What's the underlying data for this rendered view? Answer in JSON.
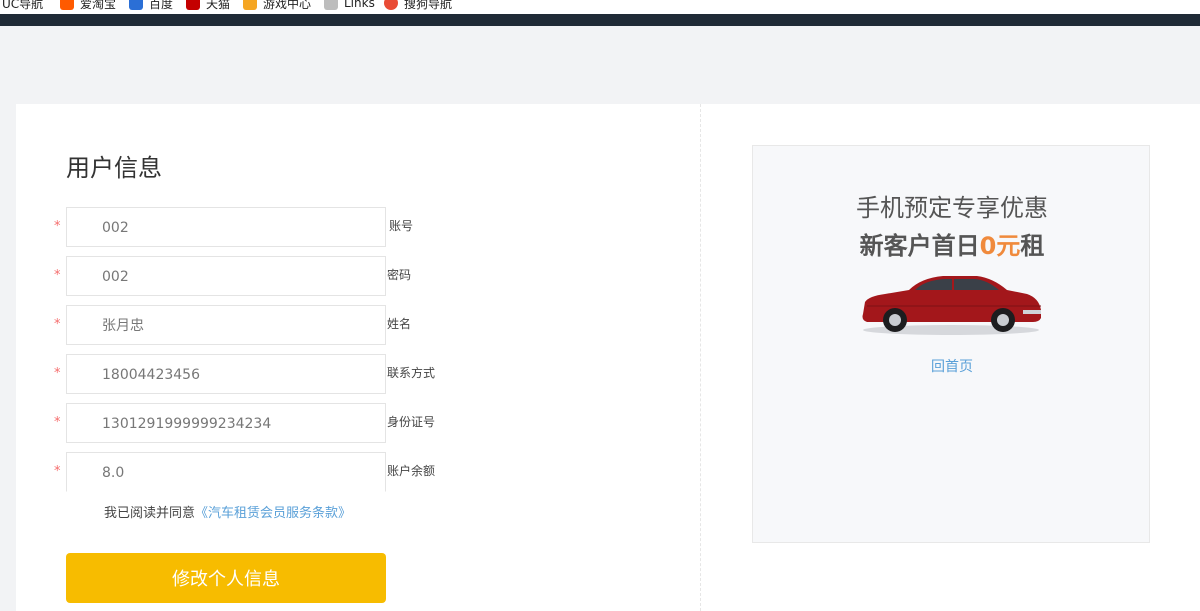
{
  "bookmarks": [
    {
      "label": "UC导航",
      "icon": "uc-icon",
      "color": "#f39c12"
    },
    {
      "label": "爱淘宝",
      "icon": "taobao-icon",
      "color": "#ff5a00"
    },
    {
      "label": "百度",
      "icon": "baidu-icon",
      "color": "#2b6fd6"
    },
    {
      "label": "天猫",
      "icon": "tmall-icon",
      "color": "#c40000"
    },
    {
      "label": "游戏中心",
      "icon": "game-center-icon",
      "color": "#f5a623"
    },
    {
      "label": "Links",
      "icon": "folder-icon",
      "color": "#bdbdbd"
    },
    {
      "label": "搜狗导航",
      "icon": "sogou-icon",
      "color": "#e94b35"
    }
  ],
  "page": {
    "title": "用户信息",
    "required_mark": "*"
  },
  "form": {
    "fields": [
      {
        "name": "account",
        "label": "账号",
        "value": "002"
      },
      {
        "name": "password",
        "label": "密码",
        "value": "002"
      },
      {
        "name": "realname",
        "label": "姓名",
        "value": "张月忠"
      },
      {
        "name": "phone",
        "label": "联系方式",
        "value": "18004423456"
      },
      {
        "name": "id-number",
        "label": "身份证号",
        "value": "1301291999999234234"
      },
      {
        "name": "balance",
        "label": "账户余额",
        "value": "8.0"
      }
    ],
    "agree_text": "我已阅读并同意",
    "terms_link": "《汽车租赁会员服务条款》",
    "submit_label": "修改个人信息"
  },
  "promo": {
    "line1": "手机预定专享优惠",
    "line2_prefix": "新客户首日",
    "line2_highlight": "0元",
    "line2_suffix": "租",
    "home_link": "回首页",
    "image": "red-sedan-car"
  },
  "colors": {
    "accent": "#f7bc00",
    "link": "#5aa0d8",
    "highlight": "#f08a3c",
    "required": "#f56c6c"
  }
}
